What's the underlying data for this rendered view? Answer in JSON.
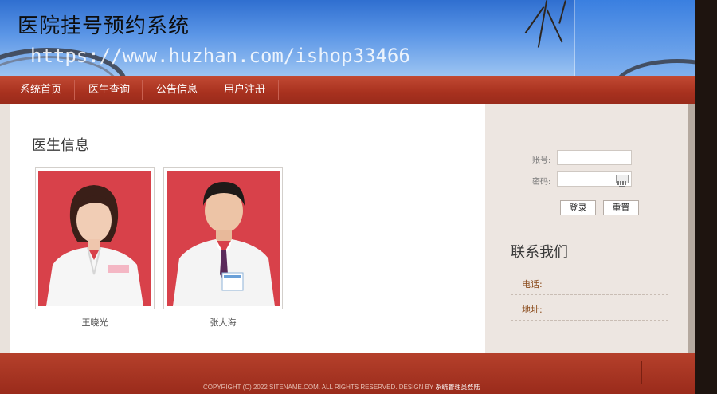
{
  "header": {
    "site_title": "医院挂号预约系统",
    "watermark": "https://www.huzhan.com/ishop33466"
  },
  "nav": {
    "items": [
      {
        "label": "系统首页"
      },
      {
        "label": "医生查询"
      },
      {
        "label": "公告信息"
      },
      {
        "label": "用户注册"
      }
    ]
  },
  "main": {
    "section_title": "医生信息",
    "doctors": [
      {
        "name": "王晓光"
      },
      {
        "name": "张大海"
      }
    ]
  },
  "sidebar": {
    "login": {
      "account_label": "账号:",
      "account_value": "",
      "password_label": "密码:",
      "password_value": "",
      "login_button": "登录",
      "reset_button": "重置"
    },
    "contact": {
      "title": "联系我们",
      "phone_label": "电话:",
      "address_label": "地址:"
    }
  },
  "footer": {
    "copyright": "COPYRIGHT (C) 2022 SITENAME.COM. ALL RIGHTS RESERVED. DESIGN BY ",
    "admin_link": "系统管理员登陆"
  },
  "colors": {
    "nav_red": "#a8311f",
    "sidebar_bg": "#ede6e1",
    "photo_bg": "#d63b3f"
  }
}
